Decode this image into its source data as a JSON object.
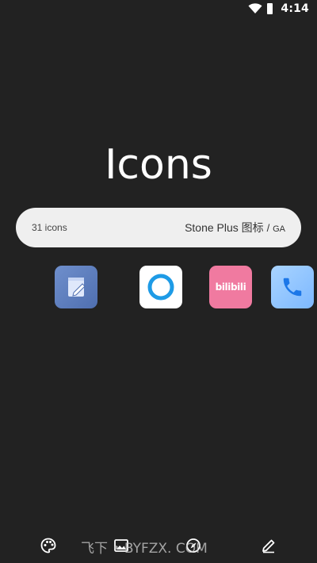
{
  "status_bar": {
    "time": "4:14",
    "icons": [
      "wifi-icon",
      "battery-icon"
    ]
  },
  "main": {
    "title": "Icons",
    "info_bar": {
      "count": "31 icons",
      "pack_name": "Stone Plus 图标",
      "separator": "/",
      "tag": "GA"
    },
    "icons": [
      {
        "icon": "notes-app-icon",
        "color": "#5b7bbd"
      },
      {
        "icon": "circle-app-icon",
        "color": "#1e9be6"
      },
      {
        "icon": "bilibili-app-icon",
        "label": "bilibili",
        "color": "#f07aa0"
      },
      {
        "icon": "phone-app-icon",
        "color": "#1c77e8"
      }
    ]
  },
  "bottom_bar": {
    "items": [
      "palette-icon",
      "image-icon",
      "compass-icon",
      "edit-icon"
    ]
  },
  "watermark": "飞下 • BYFZX. COM",
  "colors": {
    "background": "#222222",
    "pill": "#efefef",
    "text": "#ffffff"
  }
}
